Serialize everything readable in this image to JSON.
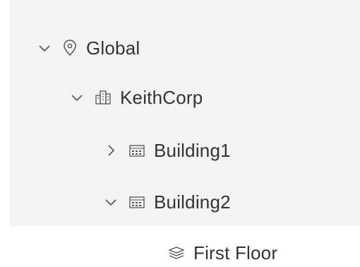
{
  "tree": {
    "global": {
      "label": "Global",
      "expanded": true,
      "icon": "location-pin-icon"
    },
    "keithcorp": {
      "label": "KeithCorp",
      "expanded": true,
      "icon": "buildings-group-icon"
    },
    "building1": {
      "label": "Building1",
      "expanded": false,
      "icon": "building-icon"
    },
    "building2": {
      "label": "Building2",
      "expanded": true,
      "icon": "building-icon"
    },
    "first_floor": {
      "label": "First Floor",
      "icon": "floor-layers-icon"
    }
  }
}
